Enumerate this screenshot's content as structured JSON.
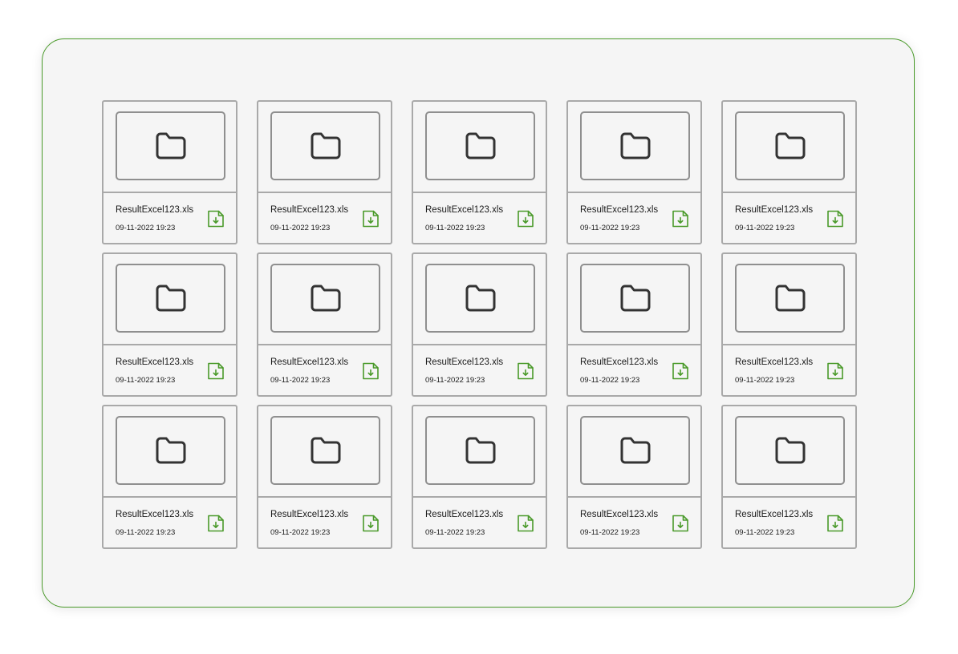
{
  "colors": {
    "accent": "#4a9a2a",
    "panel_bg": "#f5f5f5",
    "card_border": "#a9a9a9",
    "folder_icon": "#333333"
  },
  "icons": {
    "thumbnail": "folder-icon",
    "action": "file-download-icon"
  },
  "files": [
    {
      "name": "ResultExcel123.xls",
      "date": "09-11-2022 19:23"
    },
    {
      "name": "ResultExcel123.xls",
      "date": "09-11-2022 19:23"
    },
    {
      "name": "ResultExcel123.xls",
      "date": "09-11-2022 19:23"
    },
    {
      "name": "ResultExcel123.xls",
      "date": "09-11-2022 19:23"
    },
    {
      "name": "ResultExcel123.xls",
      "date": "09-11-2022 19:23"
    },
    {
      "name": "ResultExcel123.xls",
      "date": "09-11-2022 19:23"
    },
    {
      "name": "ResultExcel123.xls",
      "date": "09-11-2022 19:23"
    },
    {
      "name": "ResultExcel123.xls",
      "date": "09-11-2022 19:23"
    },
    {
      "name": "ResultExcel123.xls",
      "date": "09-11-2022 19:23"
    },
    {
      "name": "ResultExcel123.xls",
      "date": "09-11-2022 19:23"
    },
    {
      "name": "ResultExcel123.xls",
      "date": "09-11-2022 19:23"
    },
    {
      "name": "ResultExcel123.xls",
      "date": "09-11-2022 19:23"
    },
    {
      "name": "ResultExcel123.xls",
      "date": "09-11-2022 19:23"
    },
    {
      "name": "ResultExcel123.xls",
      "date": "09-11-2022 19:23"
    },
    {
      "name": "ResultExcel123.xls",
      "date": "09-11-2022 19:23"
    }
  ]
}
